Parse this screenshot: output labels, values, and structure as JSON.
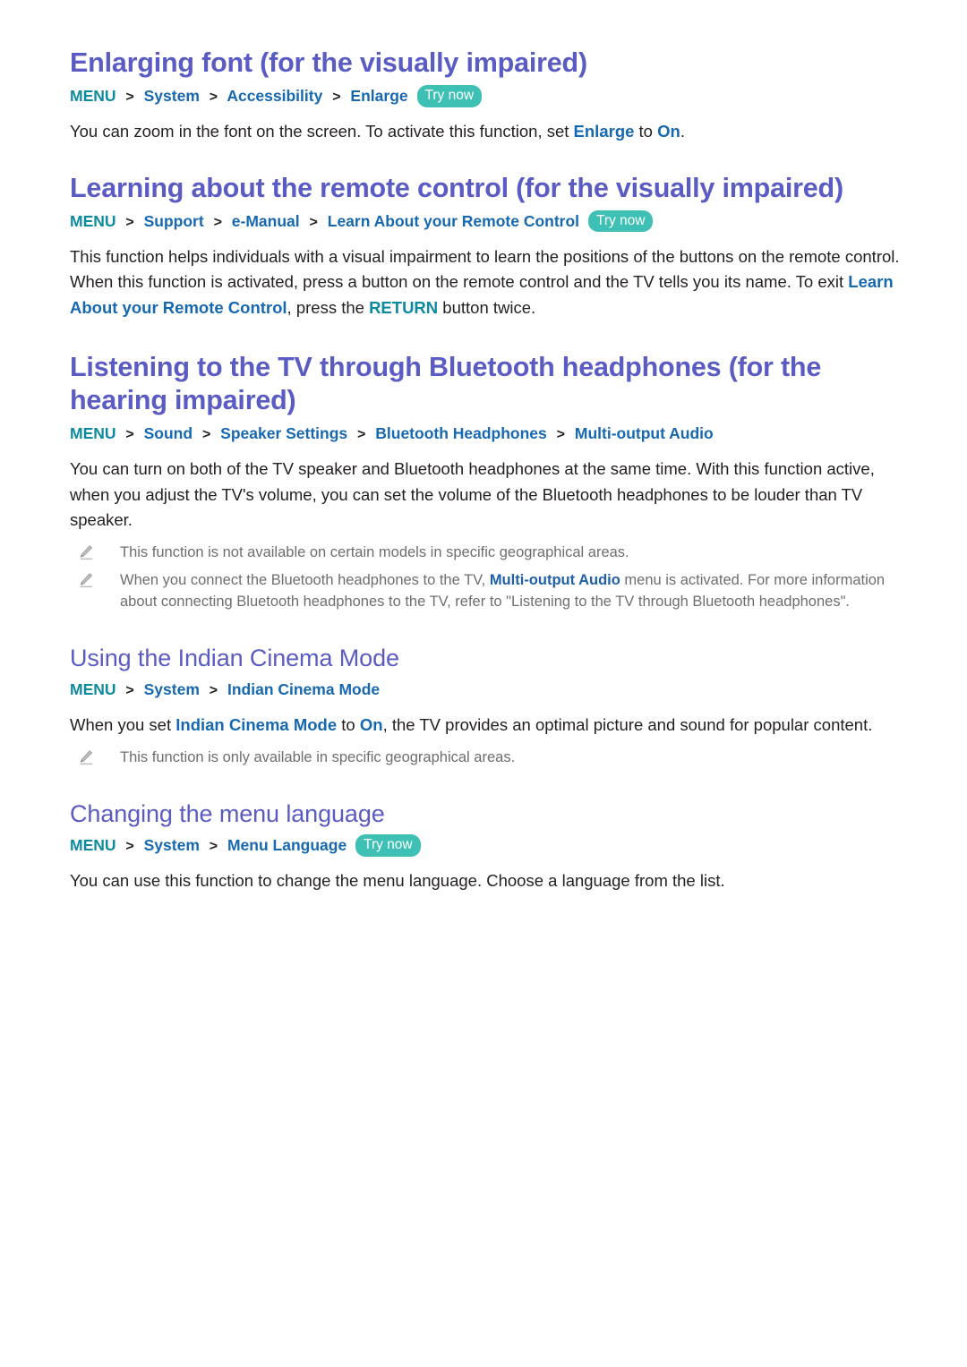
{
  "document": {
    "colors": {
      "heading": "#5b5bc4",
      "menu_root": "#0c8a9e",
      "breadcrumb_step": "#1668b0",
      "try_now_badge": "#3ec1b4",
      "body_text": "#231f20",
      "note_text": "#6d6e70"
    },
    "separator": ">",
    "try_now_label": "Try now"
  },
  "sections": [
    {
      "id": "enlarging-font",
      "heading": "Enlarging font (for the visually impaired)",
      "breadcrumb": {
        "root": "MENU",
        "steps": [
          "System",
          "Accessibility",
          "Enlarge"
        ],
        "try_now": "Try now"
      },
      "paragraph": {
        "part1": "You can zoom in the font on the screen. To activate this function, set ",
        "link1": "Enlarge",
        "part2": " to ",
        "link2": "On",
        "part3": "."
      }
    },
    {
      "id": "learning-remote-control",
      "heading": "Learning about the remote control (for the visually impaired)",
      "breadcrumb": {
        "root": "MENU",
        "steps": [
          "Support",
          "e-Manual",
          "Learn About your Remote Control"
        ],
        "try_now": "Try now"
      },
      "paragraph": {
        "part1": "This function helps individuals with a visual impairment to learn the positions of the buttons on the remote control. When this function is activated, press a button on the remote control and the TV tells you its name. To exit ",
        "link1": "Learn About your Remote Control",
        "part2": ", press the ",
        "link2": "RETURN",
        "part3": " button twice."
      }
    },
    {
      "id": "bluetooth-headphones",
      "heading": "Listening to the TV through Bluetooth headphones (for the hearing impaired)",
      "breadcrumb": {
        "root": "MENU",
        "steps": [
          "Sound",
          "Speaker Settings",
          "Bluetooth Headphones",
          "Multi-output Audio"
        ],
        "try_now": null
      },
      "paragraph": {
        "text": "You can turn on both of the TV speaker and Bluetooth headphones at the same time. With this function active, when you adjust the TV's volume, you can set the volume of the Bluetooth headphones to be louder than TV speaker."
      },
      "notes": [
        {
          "icon": "pencil-icon",
          "text": "This function is not available on certain models in specific geographical areas."
        },
        {
          "icon": "pencil-icon",
          "part1": "When you connect the Bluetooth headphones to the TV, ",
          "link1": "Multi-output Audio",
          "part2": " menu is activated. For more information about connecting Bluetooth headphones to the TV, refer to \"Listening to the TV through Bluetooth headphones\"."
        }
      ]
    },
    {
      "id": "indian-cinema-mode",
      "heading": "Using the Indian Cinema Mode",
      "breadcrumb": {
        "root": "MENU",
        "steps": [
          "System",
          "Indian Cinema Mode"
        ],
        "try_now": null
      },
      "paragraph": {
        "part1": "When you set ",
        "link1": "Indian Cinema Mode",
        "part2": " to ",
        "link2": "On",
        "part3": ", the TV provides an optimal picture and sound for popular content."
      },
      "notes": [
        {
          "icon": "pencil-icon",
          "text": "This function is only available in specific geographical areas."
        }
      ]
    },
    {
      "id": "changing-menu-language",
      "heading": "Changing the menu language",
      "breadcrumb": {
        "root": "MENU",
        "steps": [
          "System",
          "Menu Language"
        ],
        "try_now": "Try now"
      },
      "paragraph": {
        "text": "You can use this function to change the menu language. Choose a language from the list."
      }
    }
  ]
}
